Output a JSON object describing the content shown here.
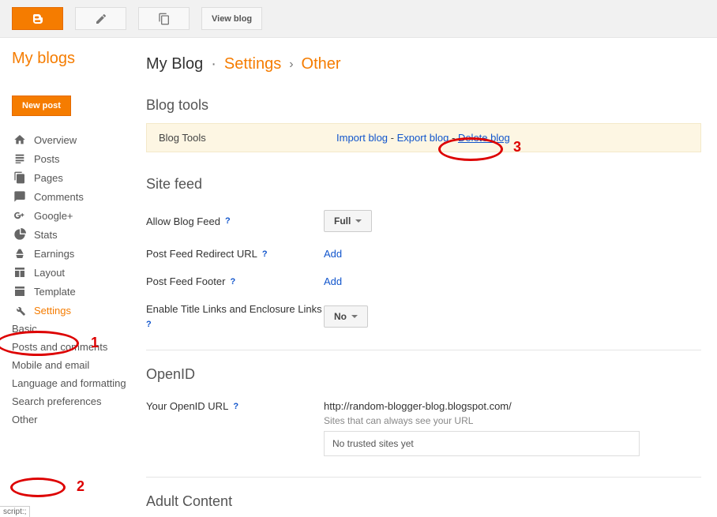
{
  "topbar": {
    "create_icon": "B",
    "view_blog": "View blog"
  },
  "sidebar": {
    "title": "My blogs",
    "new_post": "New post",
    "items": {
      "overview": "Overview",
      "posts": "Posts",
      "pages": "Pages",
      "comments": "Comments",
      "googleplus": "Google+",
      "stats": "Stats",
      "earnings": "Earnings",
      "layout": "Layout",
      "template": "Template",
      "settings": "Settings"
    },
    "settings_sub": {
      "basic": "Basic",
      "posts_comments": "Posts and comments",
      "mobile_email": "Mobile and email",
      "lang_fmt": "Language and formatting",
      "search_prefs": "Search preferences",
      "other": "Other"
    }
  },
  "crumb": {
    "blog": "My Blog",
    "settings": "Settings",
    "other": "Other",
    "sep": "›",
    "dot": "·"
  },
  "sections": {
    "blog_tools": {
      "heading": "Blog tools",
      "label": "Blog Tools",
      "import": "Import blog",
      "export": "Export blog",
      "delete": "Delete blog",
      "dash": " - "
    },
    "site_feed": {
      "heading": "Site feed",
      "allow": "Allow Blog Feed",
      "allow_val": "Full",
      "redirect": "Post Feed Redirect URL",
      "redirect_val": "Add",
      "footer": "Post Feed Footer",
      "footer_val": "Add",
      "title_links": "Enable Title Links and Enclosure Links",
      "title_links_val": "No"
    },
    "openid": {
      "heading": "OpenID",
      "your_url": "Your OpenID URL",
      "url_val": "http://random-blogger-blog.blogspot.com/",
      "sites_txt": "Sites that can always see your URL",
      "trusted": "No trusted sites yet"
    },
    "adult": {
      "heading": "Adult Content"
    },
    "help": "?"
  },
  "annotations": {
    "n1": "1",
    "n2": "2",
    "n3": "3"
  },
  "status_corner": "script:;"
}
